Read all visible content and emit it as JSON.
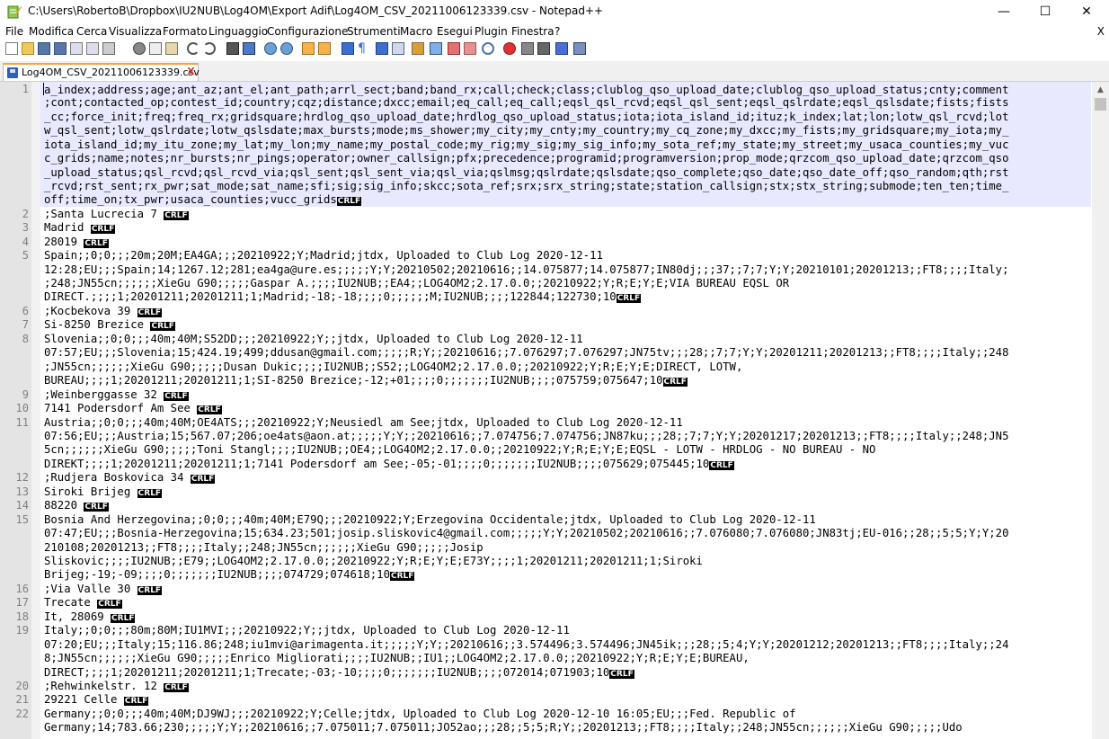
{
  "window": {
    "title": "C:\\Users\\RobertoB\\Dropbox\\IU2NUB\\Log4OM\\Export Adif\\Log4OM_CSV_20211006123339.csv - Notepad++",
    "minimize": "—",
    "maximize": "☐",
    "close": "✕"
  },
  "menu": {
    "items": [
      "File",
      "Modifica",
      "Cerca",
      "Visualizza",
      "Formato",
      "Linguaggio",
      "Configurazione",
      "Strumenti",
      "Macro",
      "Esegui",
      "Plugin",
      "Finestra",
      "?"
    ],
    "close": "X"
  },
  "tab": {
    "label": "Log4OM_CSV_20211006123339.csv",
    "close": "X"
  },
  "editor": {
    "line_numbers": [
      "1",
      "2",
      "3",
      "4",
      "5",
      "6",
      "7",
      "8",
      "9",
      "10",
      "11",
      "12",
      "13",
      "14",
      "15",
      "16",
      "17",
      "18",
      "19",
      "20",
      "21",
      "22"
    ],
    "crlf": "CRLF",
    "lines": [
      "a_index;address;age;ant_az;ant_el;ant_path;arrl_sect;band;band_rx;call;check;class;clublog_qso_upload_date;clublog_qso_upload_status;cnty;comment",
      ";cont;contacted_op;contest_id;country;cqz;distance;dxcc;email;eq_call;eq_call;eqsl_qsl_rcvd;eqsl_qsl_sent;eqsl_qslrdate;eqsl_qslsdate;fists;fists",
      "_cc;force_init;freq;freq_rx;gridsquare;hrdlog_qso_upload_date;hrdlog_qso_upload_status;iota;iota_island_id;ituz;k_index;lat;lon;lotw_qsl_rcvd;lot",
      "w_qsl_sent;lotw_qslrdate;lotw_qslsdate;max_bursts;mode;ms_shower;my_city;my_cnty;my_country;my_cq_zone;my_dxcc;my_fists;my_gridsquare;my_iota;my_",
      "iota_island_id;my_itu_zone;my_lat;my_lon;my_name;my_postal_code;my_rig;my_sig;my_sig_info;my_sota_ref;my_state;my_street;my_usaca_counties;my_vuc",
      "c_grids;name;notes;nr_bursts;nr_pings;operator;owner_callsign;pfx;precedence;programid;programversion;prop_mode;qrzcom_qso_upload_date;qrzcom_qso",
      "_upload_status;qsl_rcvd;qsl_rcvd_via;qsl_sent;qsl_sent_via;qsl_via;qslmsg;qslrdate;qslsdate;qso_complete;qso_date;qso_date_off;qso_random;qth;rst",
      "_rcvd;rst_sent;rx_pwr;sat_mode;sat_name;sfi;sig;sig_info;skcc;sota_ref;srx;srx_string;state;station_callsign;stx;stx_string;submode;ten_ten;time_",
      "off;time_on;tx_pwr;usaca_counties;vucc_grids",
      ";Santa Lucrecia 7 ",
      "Madrid ",
      "28019 ",
      "Spain;;0;0;;;20m;20M;EA4GA;;;20210922;Y;Madrid;jtdx, Uploaded to Club Log 2020-12-11",
      "12:28;EU;;;Spain;14;1267.12;281;ea4ga@ure.es;;;;;Y;Y;20210502;20210616;;14.075877;14.075877;IN80dj;;;37;;7;7;Y;Y;20210101;20201213;;FT8;;;;Italy;",
      ";248;JN55cn;;;;;;XieGu G90;;;;;Gaspar A.;;;;IU2NUB;;EA4;;LOG4OM2;2.17.0.0;;20210922;Y;R;E;Y;E;VIA BUREAU EQSL OR",
      "DIRECT.;;;;1;20201211;20201211;1;Madrid;-18;-18;;;;0;;;;;;M;IU2NUB;;;;122844;122730;10",
      ";Kocbekova 39 ",
      "Si-8250 Brezice ",
      "Slovenia;;0;0;;;40m;40M;S52DD;;;20210922;Y;;jtdx, Uploaded to Club Log 2020-12-11",
      "07:57;EU;;;Slovenia;15;424.19;499;ddusan@gmail.com;;;;;R;Y;;20210616;;7.076297;7.076297;JN75tv;;;28;;7;7;Y;Y;20201211;20201213;;FT8;;;;Italy;;248",
      ";JN55cn;;;;;;XieGu G90;;;;;Dusan Dukic;;;;IU2NUB;;S52;;LOG4OM2;2.17.0.0;;20210922;Y;R;E;Y;E;DIRECT, LOTW,",
      "BUREAU;;;;1;20201211;20201211;1;SI-8250 Brezice;-12;+01;;;;0;;;;;;;IU2NUB;;;;075759;075647;10",
      ";Weinberggasse 32 ",
      "7141 Podersdorf Am See ",
      "Austria;;0;0;;;40m;40M;OE4ATS;;;20210922;Y;Neusiedl am See;jtdx, Uploaded to Club Log 2020-12-11",
      "07:56;EU;;;Austria;15;567.07;206;oe4ats@aon.at;;;;;Y;Y;;20210616;;7.074756;7.074756;JN87ku;;;28;;7;7;Y;Y;20201217;20201213;;FT8;;;;Italy;;248;JN5",
      "5cn;;;;;;XieGu G90;;;;;Toni Stangl;;;;IU2NUB;;OE4;;LOG4OM2;2.17.0.0;;20210922;Y;R;E;Y;E;EQSL - LOTW - HRDLOG - NO BUREAU - NO",
      "DIREKT;;;;1;20201211;20201211;1;7141 Podersdorf am See;-05;-01;;;;0;;;;;;;IU2NUB;;;;075629;075445;10",
      ";Rudjera Boskovica 34 ",
      "Siroki Brijeg ",
      "88220 ",
      "Bosnia And Herzegovina;;0;0;;;40m;40M;E79Q;;;20210922;Y;Erzegovina Occidentale;jtdx, Uploaded to Club Log 2020-12-11",
      "07:47;EU;;;Bosnia-Herzegovina;15;634.23;501;josip.sliskovic4@gmail.com;;;;;Y;Y;20210502;20210616;;7.076080;7.076080;JN83tj;EU-016;;28;;5;5;Y;Y;20",
      "210108;20201213;;FT8;;;;Italy;;248;JN55cn;;;;;;XieGu G90;;;;;Josip",
      "Sliskovic;;;;IU2NUB;;E79;;LOG4OM2;2.17.0.0;;20210922;Y;R;E;Y;E;E73Y;;;;1;20201211;20201211;1;Siroki",
      "Brijeg;-19;-09;;;;0;;;;;;;IU2NUB;;;;074729;074618;10",
      ";Via Valle 30 ",
      "Trecate ",
      "It, 28069 ",
      "Italy;;0;0;;;80m;80M;IU1MVI;;;20210922;Y;;jtdx, Uploaded to Club Log 2020-12-11",
      "07:20;EU;;;Italy;15;116.86;248;iu1mvi@arimagenta.it;;;;;Y;Y;;20210616;;3.574496;3.574496;JN45ik;;;28;;5;4;Y;Y;20201212;20201213;;FT8;;;;Italy;;24",
      "8;JN55cn;;;;;;XieGu G90;;;;;Enrico Migliorati;;;;IU2NUB;;IU1;;LOG4OM2;2.17.0.0;;20210922;Y;R;E;Y;E;BUREAU,",
      "DIRECT;;;;1;20201211;20201211;1;Trecate;-03;-10;;;;0;;;;;;;IU2NUB;;;;072014;071903;10",
      ";Rehwinkelstr. 12 ",
      "29221 Celle ",
      "Germany;;0;0;;;40m;40M;DJ9WJ;;;20210922;Y;Celle;jtdx, Uploaded to Club Log 2020-12-10 16:05;EU;;;Fed. Republic of",
      "Germany;14;783.66;230;;;;;Y;Y;;20210616;;7.075011;7.075011;JO52ao;;;28;;5;5;R;Y;;20201213;;FT8;;;;Italy;;248;JN55cn;;;;;;XieGu G90;;;;;Udo"
    ]
  }
}
